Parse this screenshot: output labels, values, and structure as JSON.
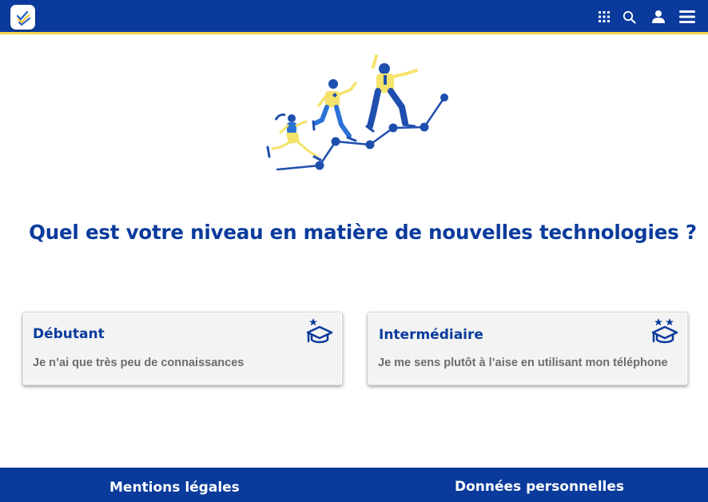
{
  "header": {
    "logo_icon": "checklist-logo-icon",
    "icons": [
      "apps-grid-icon",
      "search-icon",
      "user-icon",
      "menu-icon"
    ]
  },
  "main": {
    "question": "Quel est votre niveau en matière de nouvelles technologies ?",
    "levels": [
      {
        "title": "Débutant",
        "description": "Je n’ai que très peu de connaissances",
        "stars": 1,
        "icon": "graduation-cap-icon"
      },
      {
        "title": "Intermédiaire",
        "description": "Je me sens plutôt à l’aise en utilisant mon téléphone",
        "stars": 2,
        "icon": "graduation-cap-icon"
      }
    ]
  },
  "footer": {
    "legal_label": "Mentions légales",
    "privacy_label": "Données personnelles"
  },
  "colors": {
    "primary": "#0a3b9c",
    "accent": "#f2d54a",
    "illustration_blue": "#1f5fc2",
    "illustration_yellow": "#f5e26a"
  }
}
